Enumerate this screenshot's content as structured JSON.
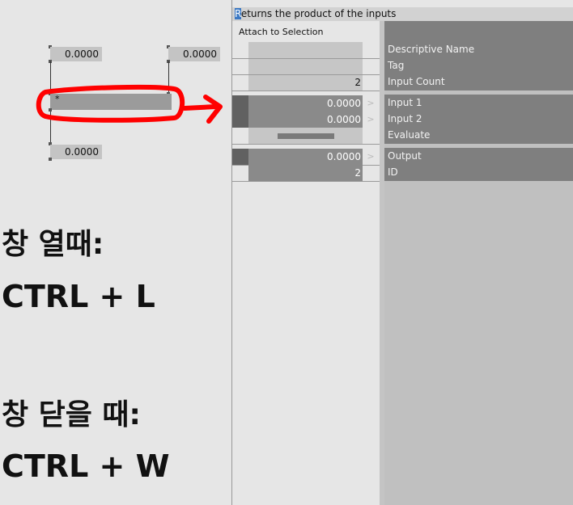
{
  "canvas": {
    "node_operator": "*",
    "input1_value": "0.0000",
    "input2_value": "0.0000",
    "output_value": "0.0000"
  },
  "hints": {
    "open_label": "창 열때:",
    "open_shortcut": "CTRL + L",
    "close_label": "창 닫을 때:",
    "close_shortcut": "CTRL + W"
  },
  "inspector": {
    "title": "Returns the product of the inputs",
    "title_first_char": "R",
    "title_rest": "eturns the product of the inputs",
    "attach_label": "Attach to Selection",
    "pins": [
      {
        "label": "Descriptive Name",
        "value": ""
      },
      {
        "label": "Tag",
        "value": ""
      },
      {
        "label": "Input Count",
        "value": "2"
      },
      {
        "label": "Input 1",
        "value": "0.0000"
      },
      {
        "label": "Input 2",
        "value": "0.0000"
      },
      {
        "label": "Evaluate",
        "value": ""
      },
      {
        "label": "Output",
        "value": "0.0000"
      },
      {
        "label": "ID",
        "value": "2"
      }
    ],
    "arrow_glyph": ">"
  },
  "colors": {
    "annotation_red": "#ff0000",
    "label_bg": "#7f7f7f",
    "value_box": "#8a8a8a",
    "cursor_blue": "#3b78c3"
  }
}
